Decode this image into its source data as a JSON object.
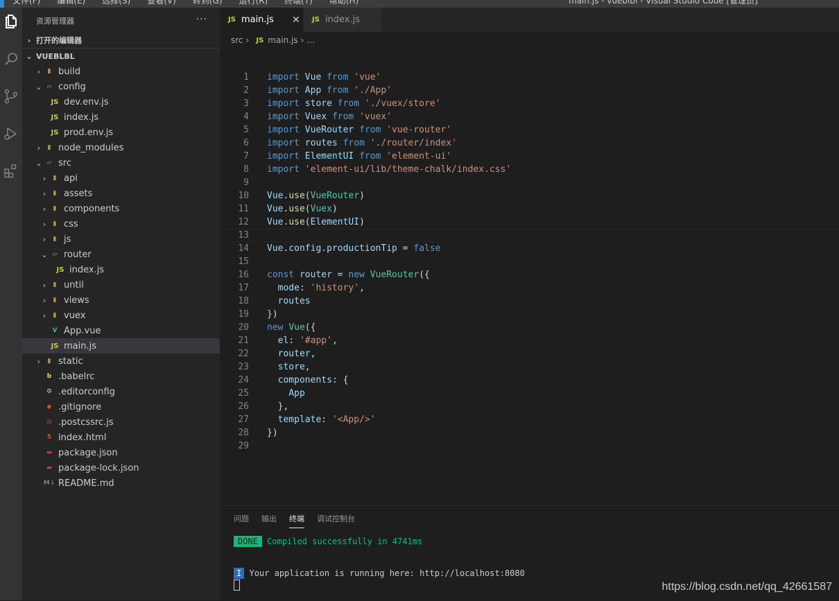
{
  "titlebar": {
    "menus": [
      "文件(F)",
      "编辑(E)",
      "选择(S)",
      "查看(V)",
      "转到(G)",
      "运行(R)",
      "终端(T)",
      "帮助(H)"
    ],
    "window_title": "main.js - vueblbl - Visual Studio Code [管理员]"
  },
  "activity": [
    "explorer-icon",
    "search-icon",
    "source-control-icon",
    "run-debug-icon",
    "extensions-icon"
  ],
  "sidebar": {
    "title": "资源管理器",
    "more": "···",
    "open_editors": "打开的编辑器",
    "project": "VUEBLBL",
    "items": [
      {
        "label": "build",
        "depth": 0,
        "type": "folder",
        "chev": "›"
      },
      {
        "label": "config",
        "depth": 0,
        "type": "folder-open",
        "chev": "⌄"
      },
      {
        "label": "dev.env.js",
        "depth": 1,
        "type": "js",
        "chev": ""
      },
      {
        "label": "index.js",
        "depth": 1,
        "type": "js",
        "chev": ""
      },
      {
        "label": "prod.env.js",
        "depth": 1,
        "type": "js",
        "chev": ""
      },
      {
        "label": "node_modules",
        "depth": 0,
        "type": "folder",
        "chev": "›"
      },
      {
        "label": "src",
        "depth": 0,
        "type": "folder-open",
        "chev": "⌄"
      },
      {
        "label": "api",
        "depth": 1,
        "type": "folder",
        "chev": "›"
      },
      {
        "label": "assets",
        "depth": 1,
        "type": "folder",
        "chev": "›"
      },
      {
        "label": "components",
        "depth": 1,
        "type": "folder",
        "chev": "›"
      },
      {
        "label": "css",
        "depth": 1,
        "type": "folder",
        "chev": "›"
      },
      {
        "label": "js",
        "depth": 1,
        "type": "folder",
        "chev": "›"
      },
      {
        "label": "router",
        "depth": 1,
        "type": "folder-open",
        "chev": "⌄"
      },
      {
        "label": "index.js",
        "depth": 2,
        "type": "js",
        "chev": ""
      },
      {
        "label": "until",
        "depth": 1,
        "type": "folder",
        "chev": "›"
      },
      {
        "label": "views",
        "depth": 1,
        "type": "folder",
        "chev": "›"
      },
      {
        "label": "vuex",
        "depth": 1,
        "type": "folder",
        "chev": "›"
      },
      {
        "label": "App.vue",
        "depth": 1,
        "type": "vue",
        "chev": ""
      },
      {
        "label": "main.js",
        "depth": 1,
        "type": "js",
        "chev": "",
        "selected": true
      },
      {
        "label": "static",
        "depth": 0,
        "type": "folder",
        "chev": "›"
      },
      {
        "label": ".babelrc",
        "depth": 0,
        "type": "babel",
        "chev": ""
      },
      {
        "label": ".editorconfig",
        "depth": 0,
        "type": "gear",
        "chev": ""
      },
      {
        "label": ".gitignore",
        "depth": 0,
        "type": "git",
        "chev": ""
      },
      {
        "label": ".postcssrc.js",
        "depth": 0,
        "type": "postcss",
        "chev": ""
      },
      {
        "label": "index.html",
        "depth": 0,
        "type": "html",
        "chev": ""
      },
      {
        "label": "package.json",
        "depth": 0,
        "type": "npm",
        "chev": ""
      },
      {
        "label": "package-lock.json",
        "depth": 0,
        "type": "npm",
        "chev": ""
      },
      {
        "label": "README.md",
        "depth": 0,
        "type": "md",
        "chev": ""
      }
    ]
  },
  "tabs": [
    {
      "label": "main.js",
      "icon": "JS",
      "active": true,
      "close": "✕"
    },
    {
      "label": "index.js",
      "icon": "JS",
      "active": false
    }
  ],
  "breadcrumb": {
    "root": "src",
    "icon": "JS",
    "file": "main.js",
    "more": "..."
  },
  "code": {
    "current_line": 13,
    "lines": [
      [
        [
          "k",
          "import"
        ],
        [
          "p",
          " "
        ],
        [
          "v",
          "Vue"
        ],
        [
          "p",
          " "
        ],
        [
          "k",
          "from"
        ],
        [
          "p",
          " "
        ],
        [
          "s",
          "'vue'"
        ]
      ],
      [
        [
          "k",
          "import"
        ],
        [
          "p",
          " "
        ],
        [
          "v",
          "App"
        ],
        [
          "p",
          " "
        ],
        [
          "k",
          "from"
        ],
        [
          "p",
          " "
        ],
        [
          "s",
          "'./App'"
        ]
      ],
      [
        [
          "k",
          "import"
        ],
        [
          "p",
          " "
        ],
        [
          "v",
          "store"
        ],
        [
          "p",
          " "
        ],
        [
          "k",
          "from"
        ],
        [
          "p",
          " "
        ],
        [
          "s",
          "'./vuex/store'"
        ]
      ],
      [
        [
          "k",
          "import"
        ],
        [
          "p",
          " "
        ],
        [
          "v",
          "Vuex"
        ],
        [
          "p",
          " "
        ],
        [
          "k",
          "from"
        ],
        [
          "p",
          " "
        ],
        [
          "s",
          "'vuex'"
        ]
      ],
      [
        [
          "k",
          "import"
        ],
        [
          "p",
          " "
        ],
        [
          "v",
          "VueRouter"
        ],
        [
          "p",
          " "
        ],
        [
          "k",
          "from"
        ],
        [
          "p",
          " "
        ],
        [
          "s",
          "'vue-router'"
        ]
      ],
      [
        [
          "k",
          "import"
        ],
        [
          "p",
          " "
        ],
        [
          "v",
          "routes"
        ],
        [
          "p",
          " "
        ],
        [
          "k",
          "from"
        ],
        [
          "p",
          " "
        ],
        [
          "s",
          "'./router/index'"
        ]
      ],
      [
        [
          "k",
          "import"
        ],
        [
          "p",
          " "
        ],
        [
          "v",
          "ElementUI"
        ],
        [
          "p",
          " "
        ],
        [
          "k",
          "from"
        ],
        [
          "p",
          " "
        ],
        [
          "s",
          "'element-ui'"
        ]
      ],
      [
        [
          "k",
          "import"
        ],
        [
          "p",
          " "
        ],
        [
          "s",
          "'element-ui/lib/theme-chalk/index.css'"
        ]
      ],
      [],
      [
        [
          "v",
          "Vue"
        ],
        [
          "p",
          "."
        ],
        [
          "f",
          "use"
        ],
        [
          "p",
          "("
        ],
        [
          "t",
          "VueRouter"
        ],
        [
          "p",
          ")"
        ]
      ],
      [
        [
          "v",
          "Vue"
        ],
        [
          "p",
          "."
        ],
        [
          "f",
          "use"
        ],
        [
          "p",
          "("
        ],
        [
          "t",
          "Vuex"
        ],
        [
          "p",
          ")"
        ]
      ],
      [
        [
          "v",
          "Vue"
        ],
        [
          "p",
          "."
        ],
        [
          "f",
          "use"
        ],
        [
          "p",
          "("
        ],
        [
          "v",
          "ElementUI"
        ],
        [
          "p",
          ")"
        ]
      ],
      [],
      [
        [
          "v",
          "Vue"
        ],
        [
          "p",
          "."
        ],
        [
          "v",
          "config"
        ],
        [
          "p",
          "."
        ],
        [
          "v",
          "productionTip"
        ],
        [
          "p",
          " = "
        ],
        [
          "kw",
          "false"
        ]
      ],
      [],
      [
        [
          "kw",
          "const"
        ],
        [
          "p",
          " "
        ],
        [
          "v",
          "router"
        ],
        [
          "p",
          " = "
        ],
        [
          "kw",
          "new"
        ],
        [
          "p",
          " "
        ],
        [
          "t",
          "VueRouter"
        ],
        [
          "p",
          "({"
        ]
      ],
      [
        [
          "p",
          "  "
        ],
        [
          "v",
          "mode"
        ],
        [
          "p",
          ": "
        ],
        [
          "s",
          "'history'"
        ],
        [
          "p",
          ","
        ]
      ],
      [
        [
          "p",
          "  "
        ],
        [
          "v",
          "routes"
        ]
      ],
      [
        [
          "p",
          "})"
        ]
      ],
      [
        [
          "kw",
          "new"
        ],
        [
          "p",
          " "
        ],
        [
          "t",
          "Vue"
        ],
        [
          "p",
          "({"
        ]
      ],
      [
        [
          "p",
          "  "
        ],
        [
          "v",
          "el"
        ],
        [
          "p",
          ": "
        ],
        [
          "s",
          "'#app'"
        ],
        [
          "p",
          ","
        ]
      ],
      [
        [
          "p",
          "  "
        ],
        [
          "v",
          "router"
        ],
        [
          "p",
          ","
        ]
      ],
      [
        [
          "p",
          "  "
        ],
        [
          "v",
          "store"
        ],
        [
          "p",
          ","
        ]
      ],
      [
        [
          "p",
          "  "
        ],
        [
          "v",
          "components"
        ],
        [
          "p",
          ": {"
        ]
      ],
      [
        [
          "p",
          "    "
        ],
        [
          "v",
          "App"
        ]
      ],
      [
        [
          "p",
          "  },"
        ]
      ],
      [
        [
          "p",
          "  "
        ],
        [
          "v",
          "template"
        ],
        [
          "p",
          ": "
        ],
        [
          "s",
          "'<App/>'"
        ]
      ],
      [
        [
          "p",
          "})"
        ]
      ],
      []
    ]
  },
  "panel": {
    "tabs": [
      "问题",
      "输出",
      "终端",
      "调试控制台"
    ],
    "active_tab": "终端",
    "done_badge": "DONE",
    "done_text": "Compiled successfully in 4741ms",
    "info_badge": "I",
    "info_text": "Your application is running here: http://localhost:8080"
  },
  "watermark": "https://blog.csdn.net/qq_42661587",
  "colors": {
    "activity": "#333333",
    "sidebar": "#252526",
    "editor": "#1e1e1e",
    "accent": "#0dbc79"
  }
}
